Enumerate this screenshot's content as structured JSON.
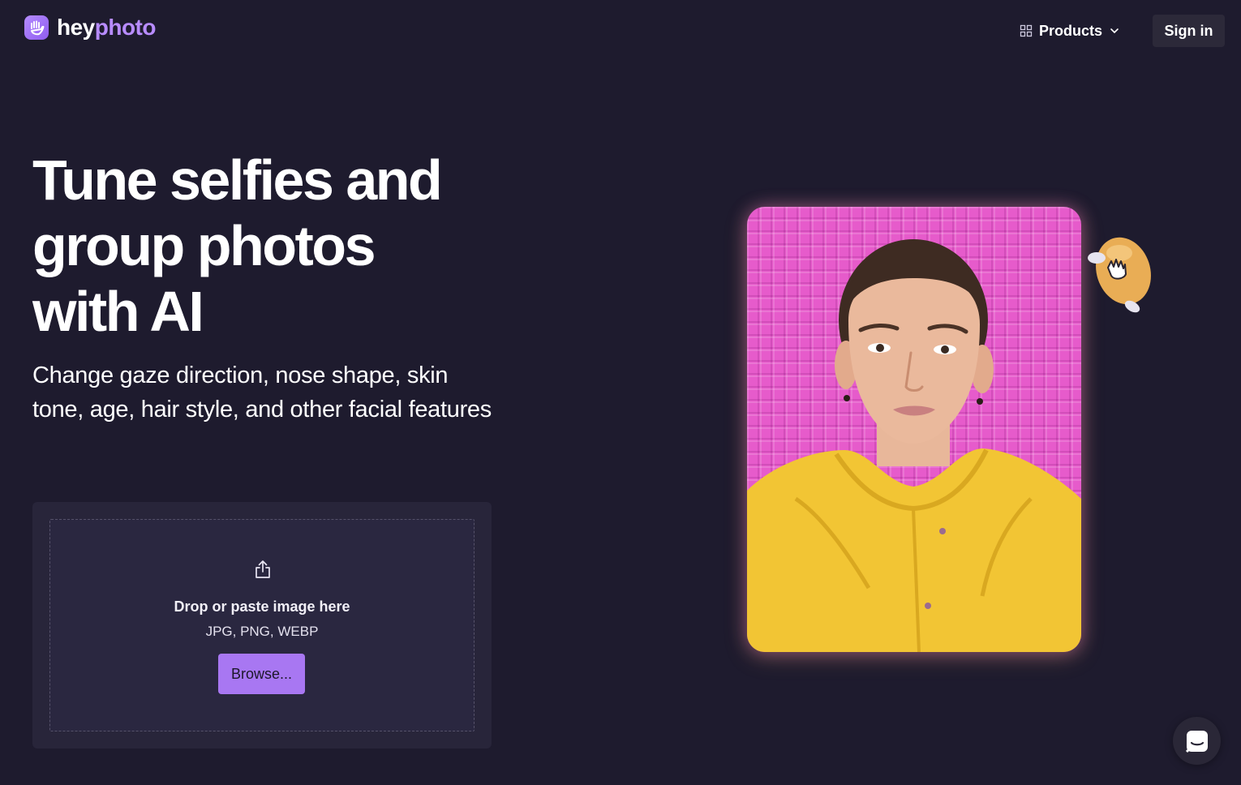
{
  "brand": {
    "part1": "hey",
    "part2": "photo",
    "accent_color": "#b88cff"
  },
  "nav": {
    "products_label": "Products",
    "signin_label": "Sign in"
  },
  "hero": {
    "headline_lines": [
      "Tune selfies and",
      "group photos",
      "with AI"
    ],
    "subheadline": "Change gaze direction, nose shape, skin tone, age, hair style, and other facial features"
  },
  "upload": {
    "title": "Drop or paste image here",
    "formats": "JPG, PNG, WEBP",
    "browse_label": "Browse..."
  },
  "colors": {
    "background": "#1e1b2e",
    "card": "#28253a",
    "button": "#a877f2",
    "photo_background": "#e65bcb",
    "jacket": "#f2c534"
  },
  "icons": {
    "logo": "hand-logo-icon",
    "products": "grid-icon",
    "dropdown": "chevron-down-icon",
    "upload": "upload-icon",
    "chat": "chat-icon",
    "mascot": "mascot-hand-cursor"
  }
}
